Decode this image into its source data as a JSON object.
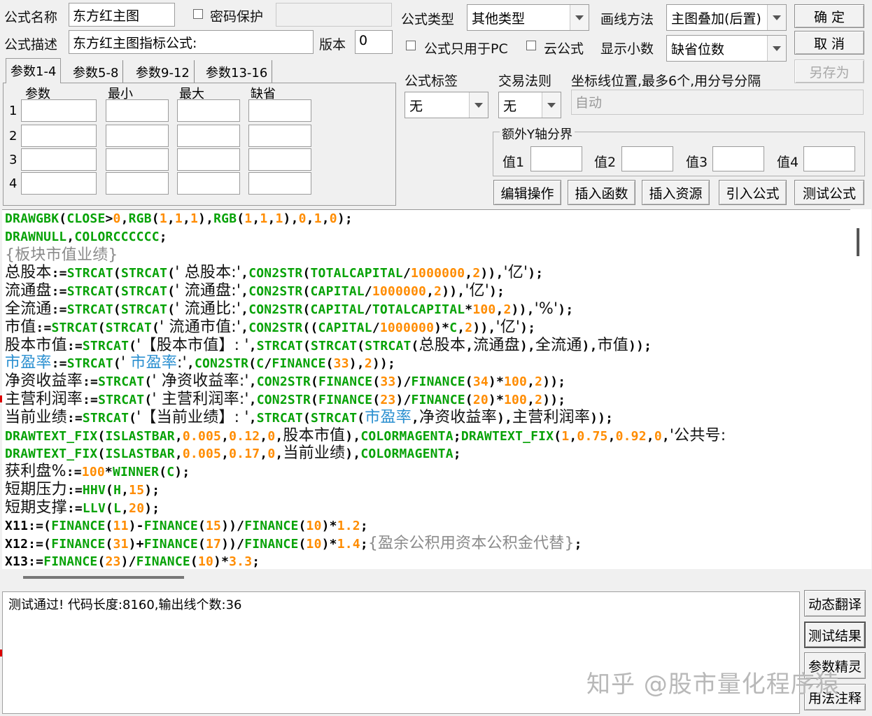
{
  "header": {
    "name_label": "公式名称",
    "name_value": "东方红主图",
    "password_label": "密码保护",
    "password_value": "",
    "desc_label": "公式描述",
    "desc_value": "东方红主图指标公式:",
    "version_label": "版本",
    "version_value": "0",
    "type_label": "公式类型",
    "type_value": "其他类型",
    "draw_label": "画线方法",
    "draw_value": "主图叠加(后置)",
    "pc_only_label": "公式只用于PC",
    "cloud_label": "云公式",
    "decimals_label": "显示小数",
    "decimals_value": "缺省位数",
    "tag_label": "公式标签",
    "tag_value": "无",
    "trade_label": "交易法则",
    "trade_value": "无",
    "axis_label": "坐标线位置,最多6个,用分号分隔",
    "axis_value": "自动",
    "extra_y_label": "额外Y轴分界",
    "val1": "值1",
    "val2": "值2",
    "val3": "值3",
    "val4": "值4"
  },
  "buttons": {
    "ok": "确  定",
    "cancel": "取  消",
    "save_as": "另存为",
    "edit_ops": "编辑操作",
    "insert_func": "插入函数",
    "insert_res": "插入资源",
    "import_formula": "引入公式",
    "test_formula": "测试公式",
    "dynamic_translate": "动态翻译",
    "test_result": "测试结果",
    "param_wizard": "参数精灵",
    "usage_note": "用法注释"
  },
  "tabs": [
    "参数1-4",
    "参数5-8",
    "参数9-12",
    "参数13-16"
  ],
  "params": {
    "headers": [
      "参数",
      "最小",
      "最大",
      "缺省"
    ],
    "rows": [
      "1",
      "2",
      "3",
      "4"
    ]
  },
  "result_text": "测试通过! 代码长度:8160,输出线个数:36",
  "watermark": "知乎 @股市量化程序猿",
  "code_lines": [
    [
      [
        "kw",
        "DRAWGBK"
      ],
      [
        "op",
        "("
      ],
      [
        "kw",
        "CLOSE"
      ],
      [
        "op",
        ">"
      ],
      [
        "num",
        "0"
      ],
      [
        "op",
        ","
      ],
      [
        "kw",
        "RGB"
      ],
      [
        "op",
        "("
      ],
      [
        "num",
        "1"
      ],
      [
        "op",
        ","
      ],
      [
        "num",
        "1"
      ],
      [
        "op",
        ","
      ],
      [
        "num",
        "1"
      ],
      [
        "op",
        "),"
      ],
      [
        "kw",
        "RGB"
      ],
      [
        "op",
        "("
      ],
      [
        "num",
        "1"
      ],
      [
        "op",
        ","
      ],
      [
        "num",
        "1"
      ],
      [
        "op",
        ","
      ],
      [
        "num",
        "1"
      ],
      [
        "op",
        "),"
      ],
      [
        "num",
        "0"
      ],
      [
        "op",
        ","
      ],
      [
        "num",
        "1"
      ],
      [
        "op",
        ","
      ],
      [
        "num",
        "0"
      ],
      [
        "op",
        ");"
      ]
    ],
    [
      [
        "kw",
        "DRAWNULL"
      ],
      [
        "op",
        ","
      ],
      [
        "kw",
        "COLORCCCCCC"
      ],
      [
        "op",
        ";"
      ]
    ],
    [
      [
        "cm",
        "{板块市值业绩}"
      ]
    ],
    [
      [
        "cjk",
        "总股本"
      ],
      [
        "op",
        ":="
      ],
      [
        "kw",
        "STRCAT"
      ],
      [
        "op",
        "("
      ],
      [
        "kw",
        "STRCAT"
      ],
      [
        "op",
        "("
      ],
      [
        "str",
        "' 总股本:'"
      ],
      [
        "op",
        ","
      ],
      [
        "kw",
        "CON2STR"
      ],
      [
        "op",
        "("
      ],
      [
        "kw",
        "TOTALCAPITAL"
      ],
      [
        "op",
        "/"
      ],
      [
        "num",
        "1000000"
      ],
      [
        "op",
        ","
      ],
      [
        "num",
        "2"
      ],
      [
        "op",
        ")),"
      ],
      [
        "str",
        "'亿'"
      ],
      [
        "op",
        ");"
      ]
    ],
    [
      [
        "cjk",
        "流通盘"
      ],
      [
        "op",
        ":="
      ],
      [
        "kw",
        "STRCAT"
      ],
      [
        "op",
        "("
      ],
      [
        "kw",
        "STRCAT"
      ],
      [
        "op",
        "("
      ],
      [
        "str",
        "' 流通盘:'"
      ],
      [
        "op",
        ","
      ],
      [
        "kw",
        "CON2STR"
      ],
      [
        "op",
        "("
      ],
      [
        "kw",
        "CAPITAL"
      ],
      [
        "op",
        "/"
      ],
      [
        "num",
        "1000000"
      ],
      [
        "op",
        ","
      ],
      [
        "num",
        "2"
      ],
      [
        "op",
        ")),"
      ],
      [
        "str",
        "'亿'"
      ],
      [
        "op",
        ");"
      ]
    ],
    [
      [
        "cjk",
        "全流通"
      ],
      [
        "op",
        ":="
      ],
      [
        "kw",
        "STRCAT"
      ],
      [
        "op",
        "("
      ],
      [
        "kw",
        "STRCAT"
      ],
      [
        "op",
        "("
      ],
      [
        "str",
        "' 流通比:'"
      ],
      [
        "op",
        ","
      ],
      [
        "kw",
        "CON2STR"
      ],
      [
        "op",
        "("
      ],
      [
        "kw",
        "CAPITAL"
      ],
      [
        "op",
        "/"
      ],
      [
        "kw",
        "TOTALCAPITAL"
      ],
      [
        "op",
        "*"
      ],
      [
        "num",
        "100"
      ],
      [
        "op",
        ","
      ],
      [
        "num",
        "2"
      ],
      [
        "op",
        ")),"
      ],
      [
        "str",
        "'%'"
      ],
      [
        "op",
        ");"
      ]
    ],
    [
      [
        "cjk",
        "市值"
      ],
      [
        "op",
        ":="
      ],
      [
        "kw",
        "STRCAT"
      ],
      [
        "op",
        "("
      ],
      [
        "kw",
        "STRCAT"
      ],
      [
        "op",
        "("
      ],
      [
        "str",
        "' 流通市值:'"
      ],
      [
        "op",
        ","
      ],
      [
        "kw",
        "CON2STR"
      ],
      [
        "op",
        "(("
      ],
      [
        "kw",
        "CAPITAL"
      ],
      [
        "op",
        "/"
      ],
      [
        "num",
        "1000000"
      ],
      [
        "op",
        ")*"
      ],
      [
        "kw",
        "C"
      ],
      [
        "op",
        ","
      ],
      [
        "num",
        "2"
      ],
      [
        "op",
        ")),"
      ],
      [
        "str",
        "'亿'"
      ],
      [
        "op",
        ");"
      ]
    ],
    [
      [
        "cjk",
        "股本市值"
      ],
      [
        "op",
        ":="
      ],
      [
        "kw",
        "STRCAT"
      ],
      [
        "op",
        "("
      ],
      [
        "str",
        "'【股本市值】: '"
      ],
      [
        "op",
        ","
      ],
      [
        "kw",
        "STRCAT"
      ],
      [
        "op",
        "("
      ],
      [
        "kw",
        "STRCAT"
      ],
      [
        "op",
        "("
      ],
      [
        "kw",
        "STRCAT"
      ],
      [
        "op",
        "("
      ],
      [
        "cjk",
        "总股本"
      ],
      [
        "op",
        ","
      ],
      [
        "cjk",
        "流通盘"
      ],
      [
        "op",
        "),"
      ],
      [
        "cjk",
        "全流通"
      ],
      [
        "op",
        "),"
      ],
      [
        "cjk",
        "市值"
      ],
      [
        "op",
        "));"
      ]
    ],
    [
      [
        "blue",
        "市盈率"
      ],
      [
        "op",
        ":="
      ],
      [
        "kw",
        "STRCAT"
      ],
      [
        "op",
        "("
      ],
      [
        "str",
        "' "
      ],
      [
        "blue",
        "市盈率"
      ],
      [
        "str",
        ":'"
      ],
      [
        "op",
        ","
      ],
      [
        "kw",
        "CON2STR"
      ],
      [
        "op",
        "("
      ],
      [
        "kw",
        "C"
      ],
      [
        "op",
        "/"
      ],
      [
        "kw",
        "FINANCE"
      ],
      [
        "op",
        "("
      ],
      [
        "num",
        "33"
      ],
      [
        "op",
        "),"
      ],
      [
        "num",
        "2"
      ],
      [
        "op",
        "));"
      ]
    ],
    [
      [
        "cjk",
        "净资收益率"
      ],
      [
        "op",
        ":="
      ],
      [
        "kw",
        "STRCAT"
      ],
      [
        "op",
        "("
      ],
      [
        "str",
        "' 净资收益率:'"
      ],
      [
        "op",
        ","
      ],
      [
        "kw",
        "CON2STR"
      ],
      [
        "op",
        "("
      ],
      [
        "kw",
        "FINANCE"
      ],
      [
        "op",
        "("
      ],
      [
        "num",
        "33"
      ],
      [
        "op",
        ")/"
      ],
      [
        "kw",
        "FINANCE"
      ],
      [
        "op",
        "("
      ],
      [
        "num",
        "34"
      ],
      [
        "op",
        ")*"
      ],
      [
        "num",
        "100"
      ],
      [
        "op",
        ","
      ],
      [
        "num",
        "2"
      ],
      [
        "op",
        "));"
      ]
    ],
    [
      [
        "cjk",
        "主营利润率"
      ],
      [
        "op",
        ":="
      ],
      [
        "kw",
        "STRCAT"
      ],
      [
        "op",
        "("
      ],
      [
        "str",
        "' 主营利润率:'"
      ],
      [
        "op",
        ","
      ],
      [
        "kw",
        "CON2STR"
      ],
      [
        "op",
        "("
      ],
      [
        "kw",
        "FINANCE"
      ],
      [
        "op",
        "("
      ],
      [
        "num",
        "23"
      ],
      [
        "op",
        ")/"
      ],
      [
        "kw",
        "FINANCE"
      ],
      [
        "op",
        "("
      ],
      [
        "num",
        "20"
      ],
      [
        "op",
        ")*"
      ],
      [
        "num",
        "100"
      ],
      [
        "op",
        ","
      ],
      [
        "num",
        "2"
      ],
      [
        "op",
        "));"
      ]
    ],
    [
      [
        "cjk",
        "当前业绩"
      ],
      [
        "op",
        ":="
      ],
      [
        "kw",
        "STRCAT"
      ],
      [
        "op",
        "("
      ],
      [
        "str",
        "'【当前业绩】: '"
      ],
      [
        "op",
        ","
      ],
      [
        "kw",
        "STRCAT"
      ],
      [
        "op",
        "("
      ],
      [
        "kw",
        "STRCAT"
      ],
      [
        "op",
        "("
      ],
      [
        "blue",
        "市盈率"
      ],
      [
        "op",
        ","
      ],
      [
        "cjk",
        "净资收益率"
      ],
      [
        "op",
        "),"
      ],
      [
        "cjk",
        "主营利润率"
      ],
      [
        "op",
        "));"
      ]
    ],
    [
      [
        "kw",
        "DRAWTEXT_FIX"
      ],
      [
        "op",
        "("
      ],
      [
        "kw",
        "ISLASTBAR"
      ],
      [
        "op",
        ","
      ],
      [
        "num",
        "0.005"
      ],
      [
        "op",
        ","
      ],
      [
        "num",
        "0.12"
      ],
      [
        "op",
        ","
      ],
      [
        "num",
        "0"
      ],
      [
        "op",
        ","
      ],
      [
        "cjk",
        "股本市值"
      ],
      [
        "op",
        "),"
      ],
      [
        "kw",
        "COLORMAGENTA"
      ],
      [
        "op",
        ";"
      ],
      [
        "kw",
        "DRAWTEXT_FIX"
      ],
      [
        "op",
        "("
      ],
      [
        "num",
        "1"
      ],
      [
        "op",
        ","
      ],
      [
        "num",
        "0.75"
      ],
      [
        "op",
        ","
      ],
      [
        "num",
        "0.92"
      ],
      [
        "op",
        ","
      ],
      [
        "num",
        "0"
      ],
      [
        "op",
        ","
      ],
      [
        "str",
        "'公共号:"
      ]
    ],
    [
      [
        "kw",
        "DRAWTEXT_FIX"
      ],
      [
        "op",
        "("
      ],
      [
        "kw",
        "ISLASTBAR"
      ],
      [
        "op",
        ","
      ],
      [
        "num",
        "0.005"
      ],
      [
        "op",
        ","
      ],
      [
        "num",
        "0.17"
      ],
      [
        "op",
        ","
      ],
      [
        "num",
        "0"
      ],
      [
        "op",
        ","
      ],
      [
        "cjk",
        "当前业绩"
      ],
      [
        "op",
        "),"
      ],
      [
        "kw",
        "COLORMAGENTA"
      ],
      [
        "op",
        ";"
      ]
    ],
    [
      [
        "cjk",
        "获利盘%"
      ],
      [
        "op",
        ":="
      ],
      [
        "num",
        "100"
      ],
      [
        "op",
        "*"
      ],
      [
        "kw",
        "WINNER"
      ],
      [
        "op",
        "("
      ],
      [
        "kw",
        "C"
      ],
      [
        "op",
        ");"
      ]
    ],
    [
      [
        "cjk",
        "短期压力"
      ],
      [
        "op",
        ":="
      ],
      [
        "kw",
        "HHV"
      ],
      [
        "op",
        "("
      ],
      [
        "kw",
        "H"
      ],
      [
        "op",
        ","
      ],
      [
        "num",
        "15"
      ],
      [
        "op",
        ");"
      ]
    ],
    [
      [
        "cjk",
        "短期支撑"
      ],
      [
        "op",
        ":="
      ],
      [
        "kw",
        "LLV"
      ],
      [
        "op",
        "("
      ],
      [
        "kw",
        "L"
      ],
      [
        "op",
        ","
      ],
      [
        "num",
        "20"
      ],
      [
        "op",
        ");"
      ]
    ],
    [
      [
        "op",
        "X11:=("
      ],
      [
        "kw",
        "FINANCE"
      ],
      [
        "op",
        "("
      ],
      [
        "num",
        "11"
      ],
      [
        "op",
        ")-"
      ],
      [
        "kw",
        "FINANCE"
      ],
      [
        "op",
        "("
      ],
      [
        "num",
        "15"
      ],
      [
        "op",
        "))/"
      ],
      [
        "kw",
        "FINANCE"
      ],
      [
        "op",
        "("
      ],
      [
        "num",
        "10"
      ],
      [
        "op",
        ")*"
      ],
      [
        "num",
        "1.2"
      ],
      [
        "op",
        ";"
      ]
    ],
    [
      [
        "op",
        "X12:=("
      ],
      [
        "kw",
        "FINANCE"
      ],
      [
        "op",
        "("
      ],
      [
        "num",
        "31"
      ],
      [
        "op",
        ")+"
      ],
      [
        "kw",
        "FINANCE"
      ],
      [
        "op",
        "("
      ],
      [
        "num",
        "17"
      ],
      [
        "op",
        "))/"
      ],
      [
        "kw",
        "FINANCE"
      ],
      [
        "op",
        "("
      ],
      [
        "num",
        "10"
      ],
      [
        "op",
        ")*"
      ],
      [
        "num",
        "1.4"
      ],
      [
        "op",
        ";"
      ],
      [
        "cm",
        "{盈余公积用资本公积金代替}"
      ],
      [
        "op",
        ";"
      ]
    ],
    [
      [
        "op",
        "X13:="
      ],
      [
        "kw",
        "FINANCE"
      ],
      [
        "op",
        "("
      ],
      [
        "num",
        "23"
      ],
      [
        "op",
        ")/"
      ],
      [
        "kw",
        "FINANCE"
      ],
      [
        "op",
        "("
      ],
      [
        "num",
        "10"
      ],
      [
        "op",
        ")*"
      ],
      [
        "num",
        "3.3"
      ],
      [
        "op",
        ";"
      ]
    ]
  ]
}
